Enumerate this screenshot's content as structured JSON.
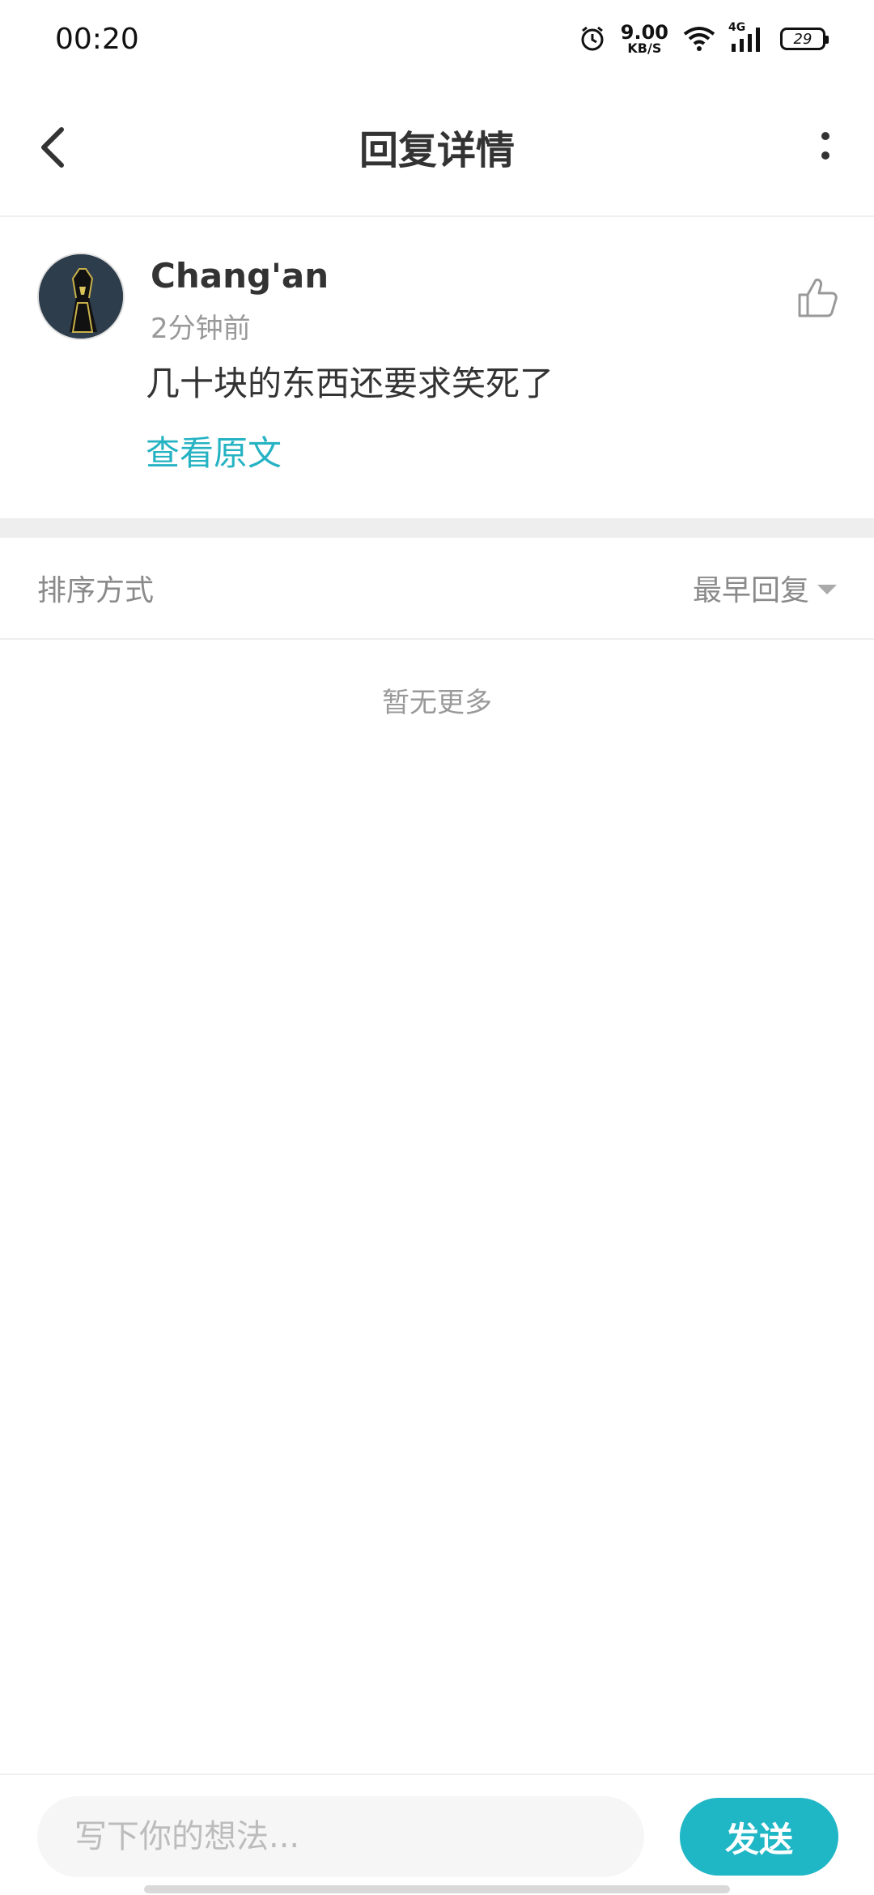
{
  "status_bar": {
    "time": "00:20",
    "net_speed": "9.00",
    "net_unit": "KB/S",
    "network": "4G",
    "battery": "29"
  },
  "header": {
    "title": "回复详情"
  },
  "post": {
    "username": "Chang'an",
    "time": "2分钟前",
    "content": "几十块的东西还要求笑死了",
    "view_original": "查看原文"
  },
  "sort": {
    "label": "排序方式",
    "selected": "最早回复"
  },
  "empty_text": "暂无更多",
  "composer": {
    "placeholder": "写下你的想法...",
    "send_label": "发送"
  },
  "colors": {
    "accent": "#1fb6c6",
    "link": "#25b3c3"
  }
}
